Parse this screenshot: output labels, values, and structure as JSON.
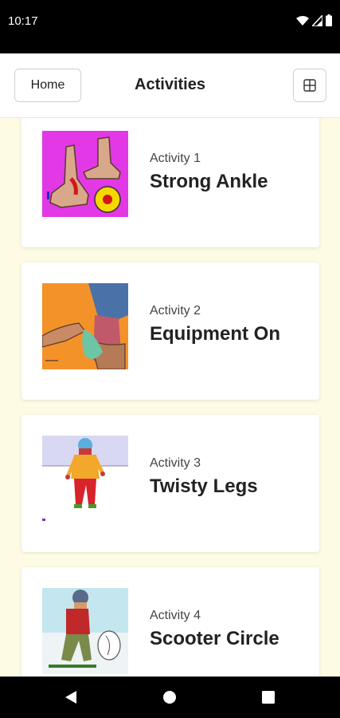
{
  "status_bar": {
    "time": "10:17"
  },
  "header": {
    "home_label": "Home",
    "title": "Activities"
  },
  "activities": [
    {
      "subtitle": "Activity 1",
      "title": "Strong Ankle"
    },
    {
      "subtitle": "Activity 2",
      "title": "Equipment On"
    },
    {
      "subtitle": "Activity 3",
      "title": "Twisty Legs"
    },
    {
      "subtitle": "Activity 4",
      "title": "Scooter Circle"
    }
  ],
  "icons": [
    "wifi-icon",
    "signal-icon",
    "battery-icon",
    "grid-view-icon",
    "back-icon",
    "home-circle-icon",
    "recents-icon"
  ]
}
